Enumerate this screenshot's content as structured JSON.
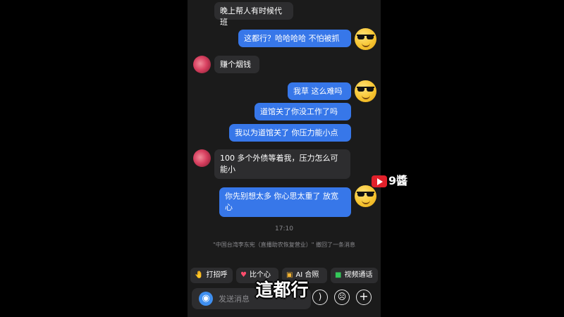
{
  "chat": {
    "messages": [
      {
        "side": "in",
        "text": "晚上帮人有时候代班"
      },
      {
        "side": "out",
        "text": "这都行？哈哈哈哈 不怕被抓"
      },
      {
        "side": "in",
        "text": "赚个烟钱"
      },
      {
        "side": "out",
        "text": "我草 这么难吗"
      },
      {
        "side": "out",
        "text": "道馆关了你没工作了吗"
      },
      {
        "side": "out",
        "text": "我以为道馆关了 你压力能小点"
      },
      {
        "side": "in",
        "text": "100 多个外债等着我，压力怎么可能小"
      },
      {
        "side": "out",
        "text": "你先别想太多 你心思太重了 放宽心"
      }
    ],
    "time": "17:10",
    "recall_notice": "\"中国台湾李东宪（直播助农恢复营业）\" 撤回了一条消息"
  },
  "quick_actions": [
    {
      "label": "打招呼",
      "icon": "wave-icon"
    },
    {
      "label": "比个心",
      "icon": "heart-icon"
    },
    {
      "label": "AI 合照",
      "icon": "ai-photo-icon"
    },
    {
      "label": "视频通话",
      "icon": "video-call-icon"
    }
  ],
  "input": {
    "placeholder": "发送消息"
  },
  "overlay": {
    "caption": "這都行",
    "logo_text": "9醬"
  },
  "colors": {
    "outgoing_bubble": "#3777e9",
    "incoming_bubble": "#2d2d2f",
    "background": "#1b1b1b"
  }
}
